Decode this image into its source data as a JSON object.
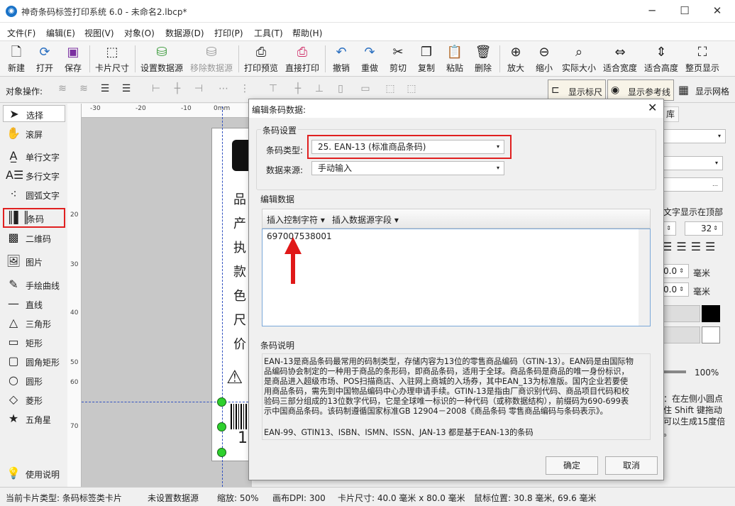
{
  "window": {
    "title": "神奇条码标签打印系统 6.0 - 未命名2.lbcp*",
    "app_icon": "app-logo-icon"
  },
  "menu": [
    "文件(F)",
    "编辑(E)",
    "视图(V)",
    "对象(O)",
    "数据源(D)",
    "打印(P)",
    "工具(T)",
    "帮助(H)"
  ],
  "toolbar": {
    "new": "新建",
    "open": "打开",
    "save": "保存",
    "card_size": "卡片尺寸",
    "set_ds": "设置数据源",
    "remove_ds": "移除数据源",
    "print_preview": "打印预览",
    "print_direct": "直接打印",
    "undo": "撤销",
    "redo": "重做",
    "cut": "剪切",
    "copy": "复制",
    "paste": "粘贴",
    "delete": "删除",
    "zoom_in": "放大",
    "zoom_out": "缩小",
    "actual": "实际大小",
    "fit_w": "适合宽度",
    "fit_h": "适合高度",
    "fit_page": "整页显示"
  },
  "objbar": {
    "label": "对象操作:",
    "show_ruler": "显示标尺",
    "show_guides": "显示参考线",
    "show_grid": "显示网格"
  },
  "tools": {
    "select": "选择",
    "scroll": "滚屏",
    "single_text": "单行文字",
    "multi_text": "多行文字",
    "arc_text": "圆弧文字",
    "barcode": "条码",
    "qrcode": "二维码",
    "image": "图片",
    "freehand": "手绘曲线",
    "line": "直线",
    "triangle": "三角形",
    "rect": "矩形",
    "round_rect": "圆角矩形",
    "circle": "圆形",
    "diamond": "菱形",
    "star": "五角星",
    "help": "使用说明"
  },
  "ruler": {
    "h": [
      "-30",
      "-20",
      "-10",
      "0mm"
    ],
    "v": [
      "20",
      "30",
      "40",
      "50",
      "60",
      "70"
    ]
  },
  "card": {
    "chars": [
      "品",
      "产",
      "执",
      "款",
      "色",
      "尺",
      "价"
    ],
    "digit": "1"
  },
  "right": {
    "tab": "库",
    "top_text": "文字显示在顶部",
    "font_size": "32",
    "v1": "0.0",
    "u1": "毫米",
    "v2": "0.0",
    "u2": "毫米",
    "opacity": "100%",
    "hint": "：在左侧小圆点 住 Shift 键拖动 可以生成15度倍 。"
  },
  "status": {
    "card_type": "当前卡片类型: 条码标签类卡片",
    "ds": "未设置数据源",
    "zoom": "缩放: 50%",
    "dpi": "画布DPI: 300",
    "card_size": "卡片尺寸: 40.0 毫米 x 80.0 毫米",
    "mouse": "鼠标位置: 30.8 毫米, 69.6 毫米"
  },
  "dialog": {
    "title": "编辑条码数据:",
    "group_settings": "条码设置",
    "type_label": "条码类型:",
    "type_value": "25.  EAN-13 (标准商品条码)",
    "source_label": "数据来源:",
    "source_value": "手动输入",
    "group_edit": "编辑数据",
    "insert_ctrl": "插入控制字符",
    "insert_field": "插入数据源字段",
    "data": "697007538001",
    "group_desc": "条码说明",
    "desc": "EAN-13是商品条码最常用的码制类型，存储内容为13位的零售商品编码（GTIN-13）。EAN码是由国际物品编码协会制定的一种用于商品的条形码，即商品条码，适用于全球。商品条码是商品的唯一身份标识，是商品进入超级市场、POS扫描商店、入驻网上商城的入场券，其中EAN_13为标准版。国内企业若要使用商品条码，需先到中国物品编码中心办理申请手续。GTIN-13是指由厂商识别代码、商品项目代码和校验码三部分组成的13位数字代码，它是全球唯一标识的一种代码（或称数据结构），前缀码为690-699表示中国商品条码。该码制遵循国家标准GB 12904－2008《商品条码 零售商品编码与条码表示》。",
    "desc2": "EAN-99、GTIN13、ISBN、ISMN、ISSN、JAN-13 都是基于EAN-13的条码",
    "ok": "确定",
    "cancel": "取消"
  }
}
